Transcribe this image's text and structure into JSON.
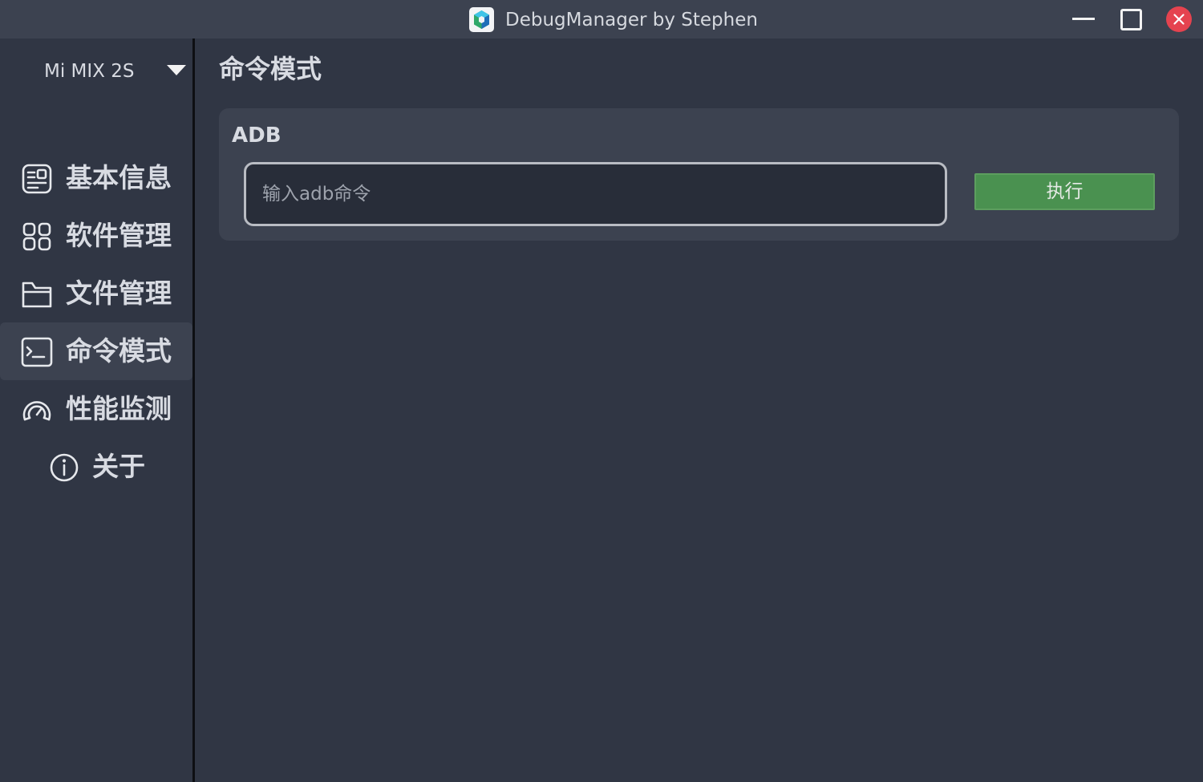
{
  "window": {
    "title": "DebugManager by Stephen",
    "controls": {
      "minimize_icon": "minimize-icon",
      "maximize_icon": "maximize-icon",
      "close_icon": "close-icon"
    }
  },
  "sidebar": {
    "device": {
      "selected": "Mi MIX 2S",
      "icon": "chevron-down-icon"
    },
    "items": [
      {
        "label": "基本信息",
        "icon": "info-card-icon",
        "active": false
      },
      {
        "label": "软件管理",
        "icon": "apps-grid-icon",
        "active": false
      },
      {
        "label": "文件管理",
        "icon": "folder-icon",
        "active": false
      },
      {
        "label": "命令模式",
        "icon": "terminal-icon",
        "active": true
      },
      {
        "label": "性能监测",
        "icon": "speedometer-icon",
        "active": false
      },
      {
        "label": "关于",
        "icon": "info-circle-icon",
        "active": false
      }
    ]
  },
  "main": {
    "title": "命令模式",
    "adb_card": {
      "title": "ADB",
      "input_value": "",
      "input_placeholder": "输入adb命令",
      "run_label": "执行"
    }
  },
  "colors": {
    "background": "#303644",
    "panel": "#3c4250",
    "titlebar": "#3c4250",
    "accent_green": "#4a9150",
    "close_red": "#e5434f",
    "text": "#d8dbe2"
  }
}
